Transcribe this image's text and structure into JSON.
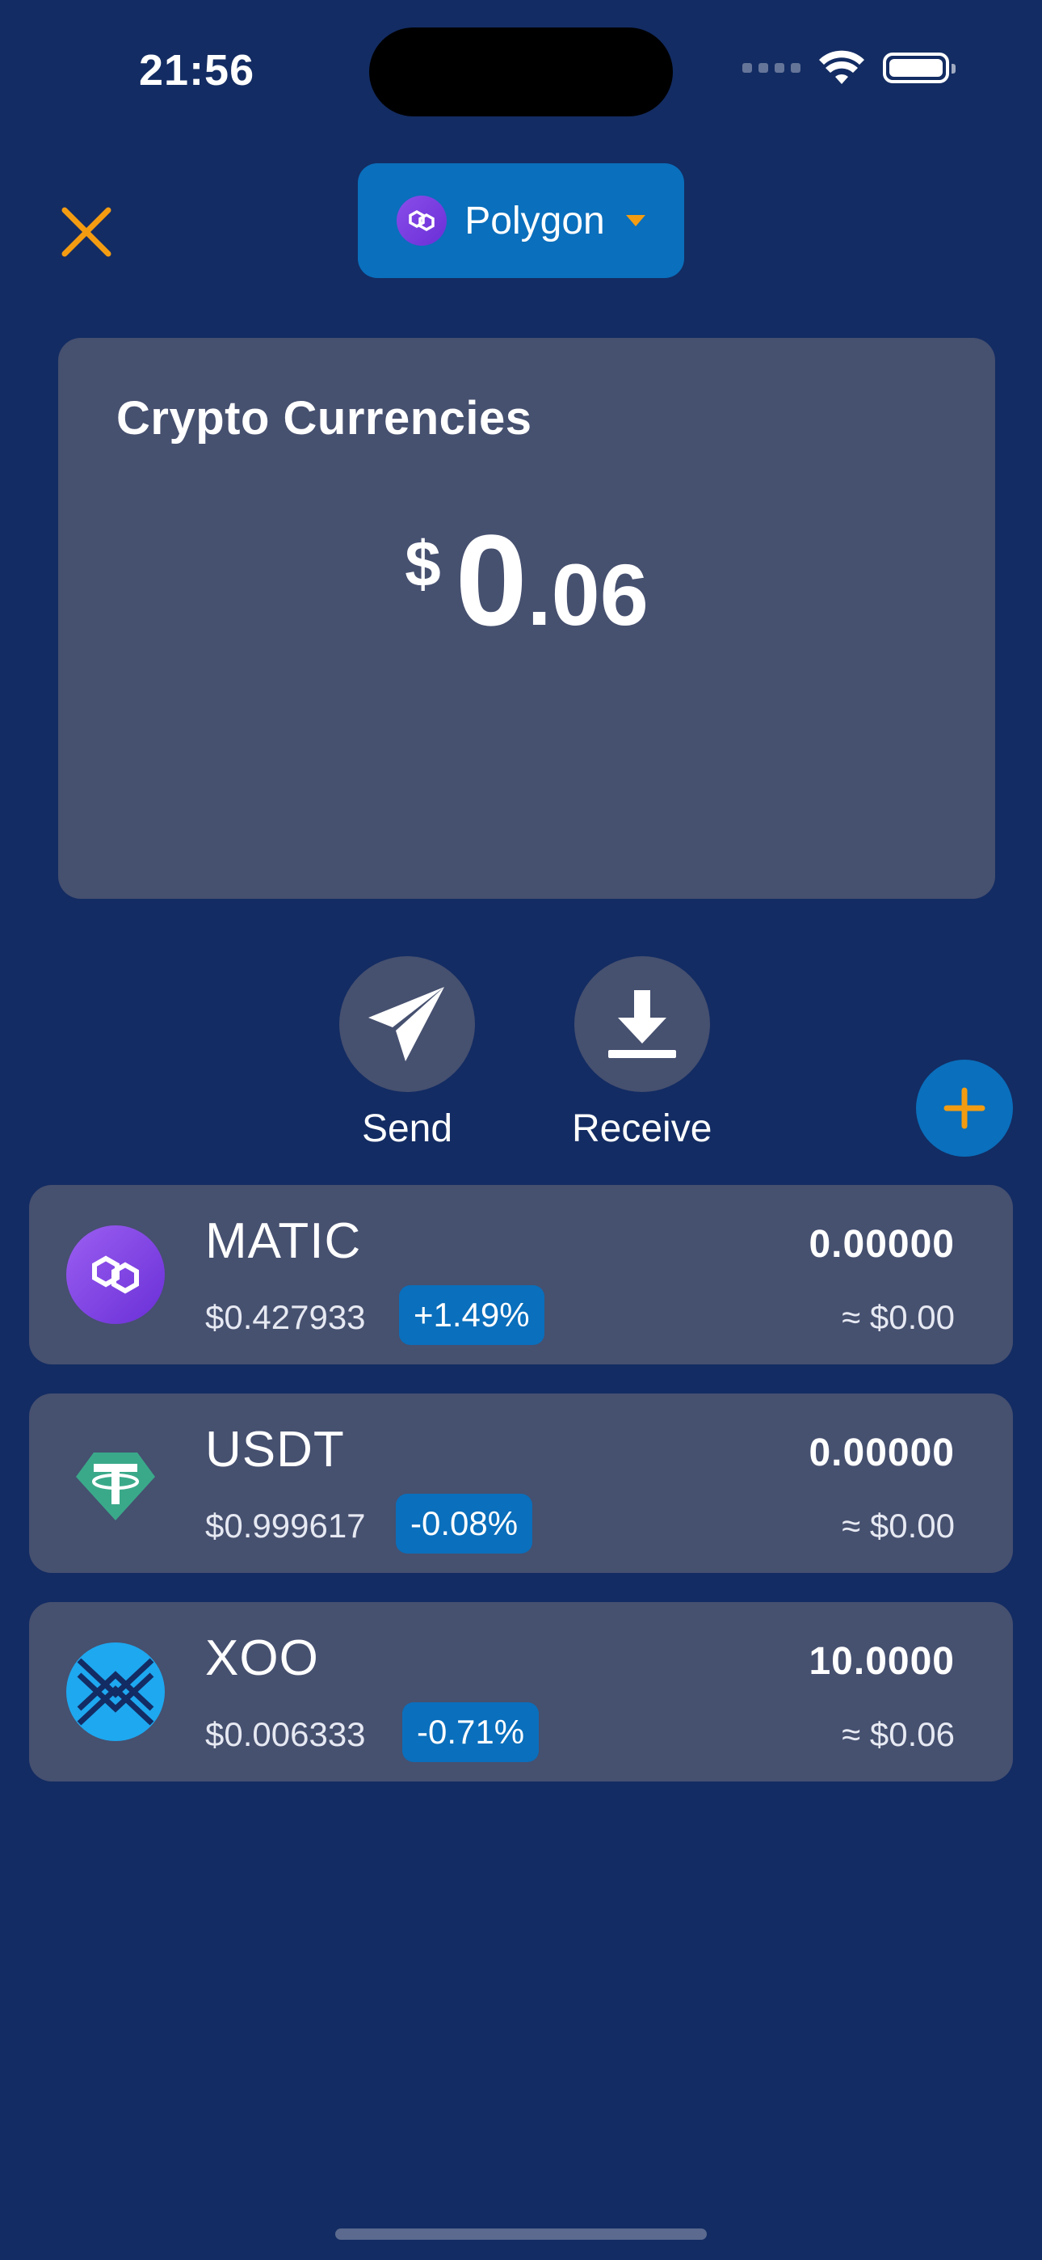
{
  "status_bar": {
    "time": "21:56"
  },
  "header": {
    "network_label": "Polygon",
    "icons": {
      "close": "close-icon",
      "network_logo": "polygon-logo-icon",
      "caret": "caret-down-icon"
    },
    "colors": {
      "close": "#f39c12",
      "pill": "#0a6fbc"
    }
  },
  "balance_card": {
    "title": "Crypto Currencies",
    "currency_symbol": "$",
    "integer_part": "0",
    "decimal_part": ".06"
  },
  "actions": {
    "send_label": "Send",
    "receive_label": "Receive",
    "icons": {
      "send": "paper-plane-icon",
      "receive": "download-icon",
      "add": "plus-icon"
    }
  },
  "tokens": [
    {
      "symbol": "MATIC",
      "price": "$0.427933",
      "change": "+1.49%",
      "amount": "0.00000",
      "value": "≈ $0.00",
      "icon": "matic-logo-icon"
    },
    {
      "symbol": "USDT",
      "price": "$0.999617",
      "change": "-0.08%",
      "amount": "0.00000",
      "value": "≈ $0.00",
      "icon": "usdt-logo-icon"
    },
    {
      "symbol": "XOO",
      "price": "$0.006333",
      "change": "-0.71%",
      "amount": "10.0000",
      "value": "≈ $0.06",
      "icon": "xoo-logo-icon"
    }
  ],
  "colors": {
    "background": "#132c63",
    "card": "#46506f",
    "accent_blue": "#0a6fbc",
    "accent_orange": "#f39c12"
  }
}
